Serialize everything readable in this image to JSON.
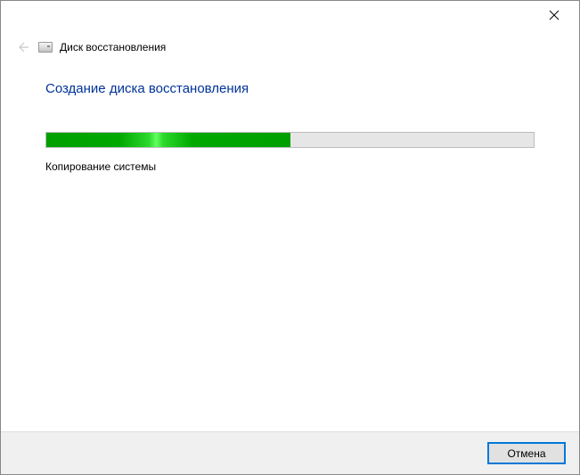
{
  "window": {
    "title": "Диск восстановления"
  },
  "page": {
    "heading": "Создание диска восстановления",
    "status": "Копирование системы",
    "progress_percent": 50
  },
  "footer": {
    "cancel_label": "Отмена"
  }
}
